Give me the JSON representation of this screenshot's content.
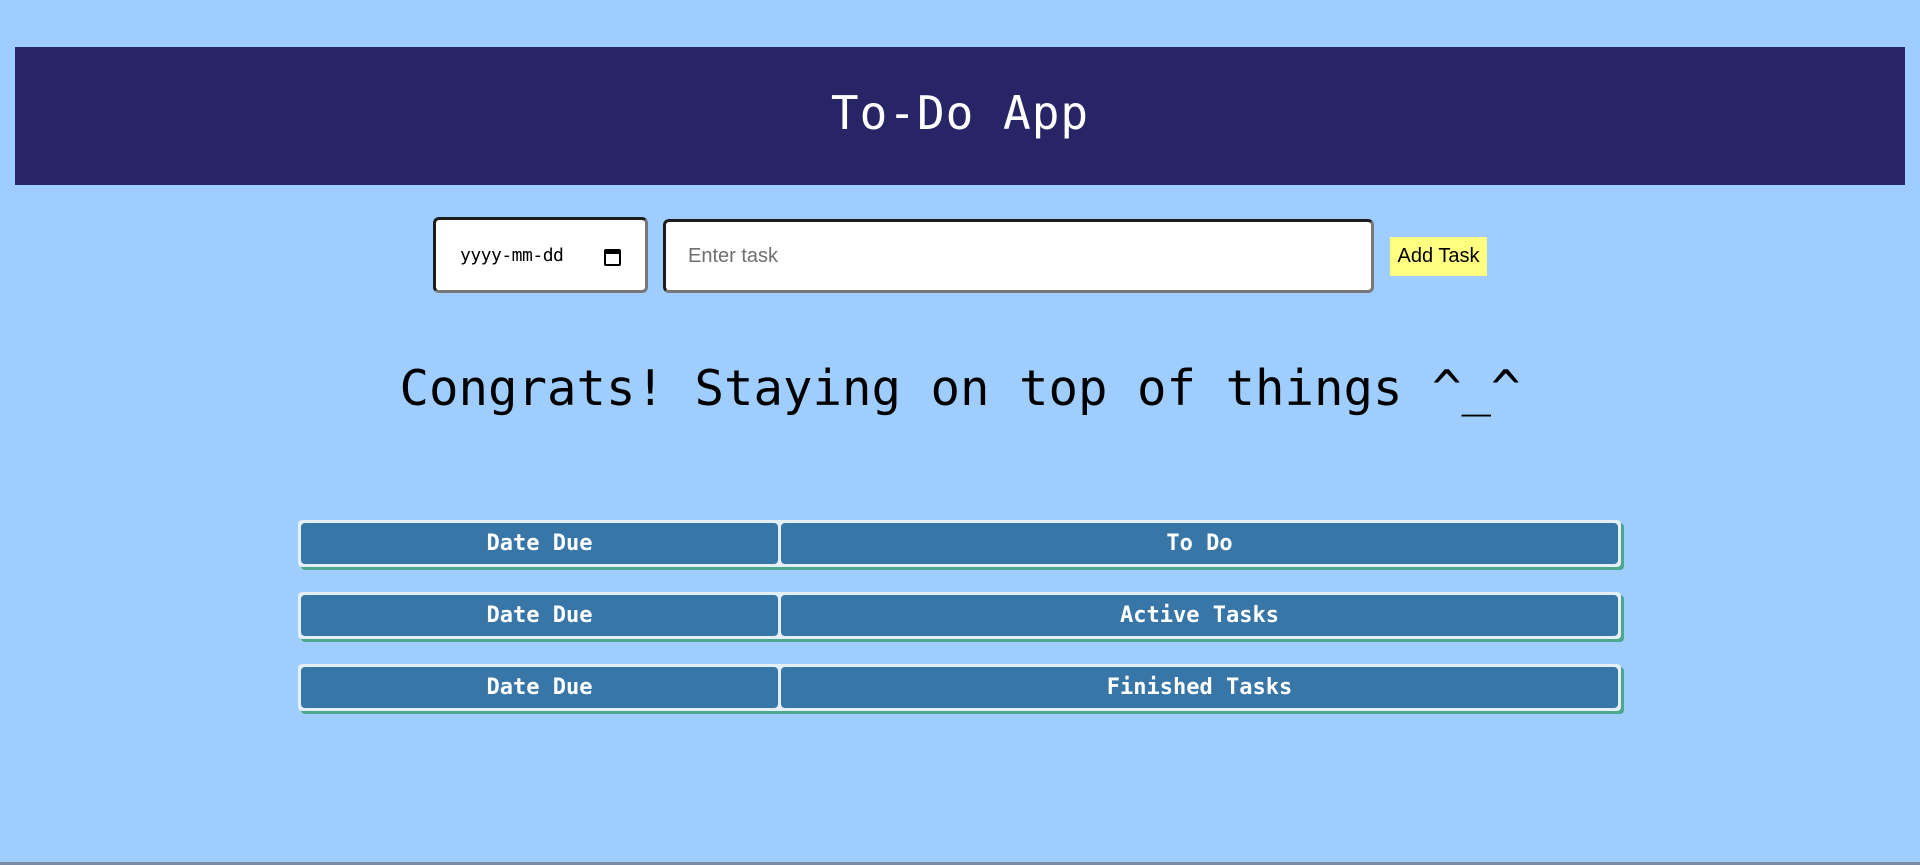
{
  "header": {
    "title": "To-Do App"
  },
  "form": {
    "date_placeholder": "yyyy-mm-dd",
    "task_placeholder": "Enter task",
    "add_button_label": "Add Task"
  },
  "status_message": "Congrats! Staying on top of things ^_^",
  "tables": [
    {
      "date_header": "Date Due",
      "title_header": "To Do"
    },
    {
      "date_header": "Date Due",
      "title_header": "Active Tasks"
    },
    {
      "date_header": "Date Due",
      "title_header": "Finished Tasks"
    }
  ],
  "colors": {
    "page_background": "#9fcefe",
    "header_background": "#282566",
    "table_header_background": "#3876a8",
    "add_button_background": "#ffff80",
    "table_accent": "#4aa88c"
  },
  "icons": {
    "date_picker": "calendar-icon"
  }
}
